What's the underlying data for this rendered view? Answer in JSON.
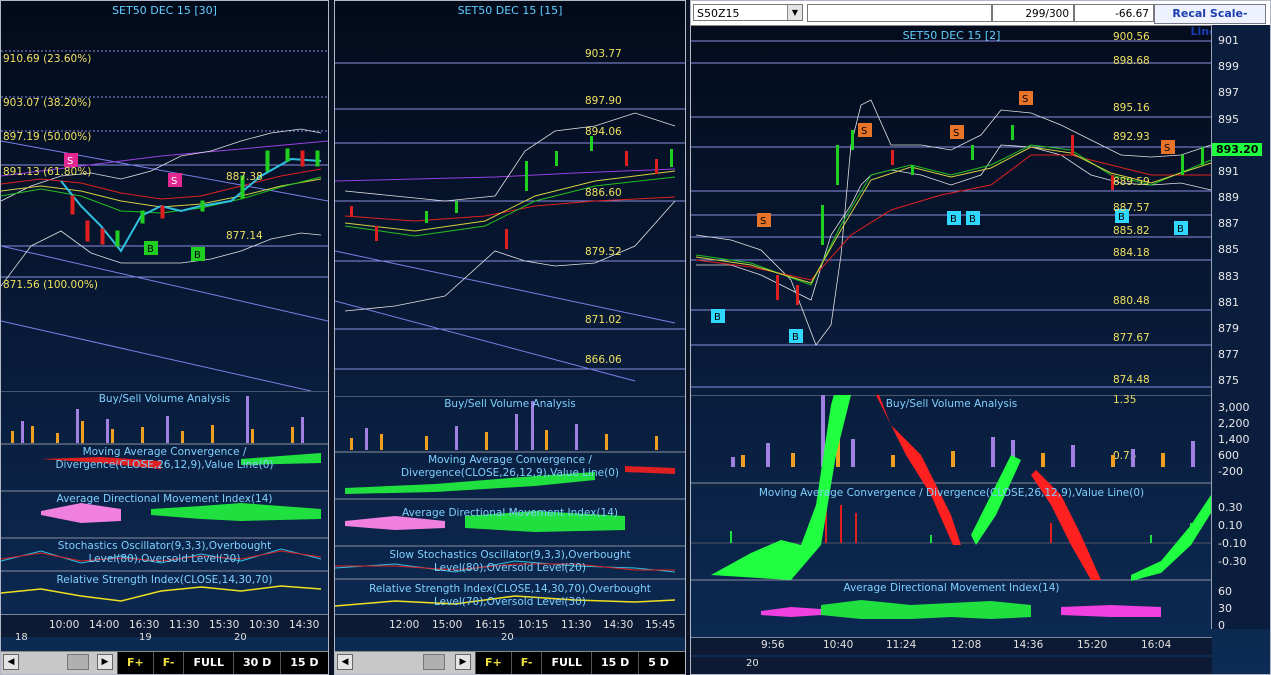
{
  "panels": [
    {
      "title": "SET50 DEC 15  [30]",
      "fib_labels": [
        "910.69 (23.60%)",
        "903.07 (38.20%)",
        "897.19 (50.00%)",
        "891.13 (61.80%)",
        "871.56 (100.00%)"
      ],
      "price_labels": [
        "887.38",
        "877.14"
      ],
      "indicators": [
        "Buy/Sell Volume Analysis",
        "Moving Average Convergence / Divergence(CLOSE,26,12,9),Value Line(0)",
        "Average Directional Movement Index(14)",
        "Stochastics Oscillator(9,3,3),Overbought Level(80),Oversold Level(20)",
        "Relative Strength Index(CLOSE,14,30,70)"
      ],
      "time_labels": [
        "10:00",
        "14:00",
        "16:30",
        "11:30",
        "15:30",
        "10:30",
        "14:30"
      ],
      "date_labels": [
        "18",
        "19",
        "20"
      ],
      "toolbar": [
        "FULL",
        "30 D",
        "15 D"
      ],
      "signals": [
        "S",
        "S",
        "B",
        "B"
      ]
    },
    {
      "title": "SET50 DEC 15  [15]",
      "price_labels": [
        "903.77",
        "897.90",
        "894.06",
        "886.60",
        "879.52",
        "871.02",
        "866.06"
      ],
      "indicators": [
        "Buy/Sell Volume Analysis",
        "Moving Average Convergence / Divergence(CLOSE,26,12,9),Value Line(0)",
        "Average Directional Movement Index(14)",
        "Slow Stochastics Oscillator(9,3,3),Overbought Level(80),Oversold Level(20)",
        "Relative Strength Index(CLOSE,14,30,70),Overbought Level(70),Oversold Level(30)"
      ],
      "time_labels": [
        "12:00",
        "15:00",
        "16:15",
        "10:15",
        "11:30",
        "14:30",
        "15:45"
      ],
      "date_labels": [
        "20"
      ],
      "toolbar": [
        "FULL",
        "15 D",
        "5 D"
      ]
    },
    {
      "title": "SET50 DEC 15  [2]",
      "symbol": "S50Z15",
      "count": "299/300",
      "change": "-66.67",
      "recal": "Recal Scale-Linear",
      "current_price": "893.20",
      "level_labels": [
        "900.56",
        "898.68",
        "895.16",
        "892.93",
        "889.59",
        "887.57",
        "885.82",
        "884.18",
        "880.48",
        "877.67",
        "874.48",
        "1.35",
        "0.75"
      ],
      "price_scale": [
        "901",
        "899",
        "897",
        "895",
        "893",
        "891",
        "889",
        "887",
        "885",
        "883",
        "881",
        "879",
        "877",
        "875"
      ],
      "volume_scale": [
        "3,000",
        "2,200",
        "1,400",
        "600",
        "-200"
      ],
      "macd_scale": [
        "0.30",
        "0.10",
        "-0.10",
        "-0.30"
      ],
      "adx_scale": [
        "60",
        "30",
        "0"
      ],
      "indicators": [
        "Buy/Sell Volume Analysis",
        "Moving Average Convergence / Divergence(CLOSE,26,12,9),Value Line(0)",
        "Average Directional Movement Index(14)"
      ],
      "time_labels": [
        "9:56",
        "10:40",
        "11:24",
        "12:08",
        "14:36",
        "15:20",
        "16:04"
      ],
      "date_labels": [
        "20"
      ],
      "signals": [
        "S",
        "S",
        "S",
        "S",
        "S",
        "B",
        "B",
        "B",
        "B",
        "B",
        "B"
      ]
    }
  ],
  "colors": {
    "price_line": "#8a8fe0",
    "label_yellow": "#f0e060",
    "title_cyan": "#5fd0ff",
    "buy_green": "#00ff40",
    "sell_red": "#ff2020",
    "signal_sell": "#e8742a",
    "signal_buy": "#30d8ff",
    "signal_s_pink": "#e02890"
  }
}
